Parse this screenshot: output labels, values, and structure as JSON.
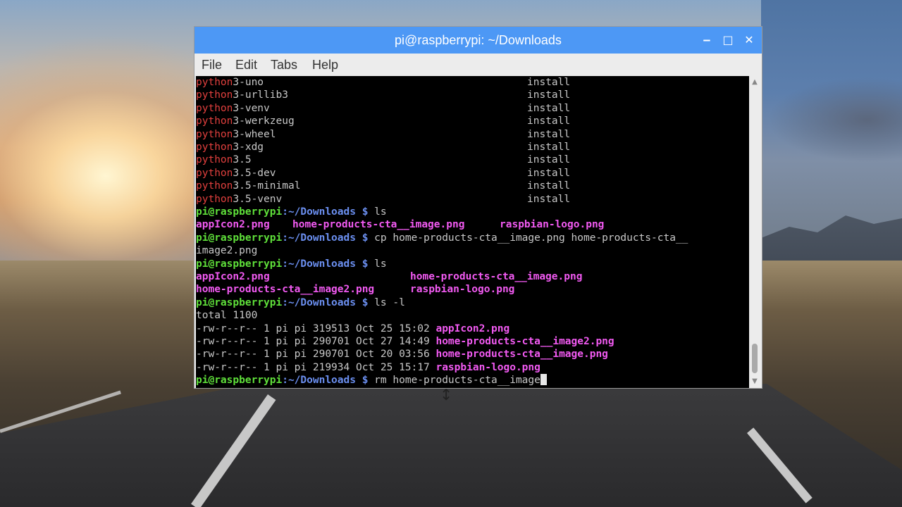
{
  "window": {
    "title": "pi@raspberrypi: ~/Downloads",
    "controls": {
      "minimize": "‒",
      "maximize": "□",
      "close": "✕"
    }
  },
  "menu": [
    "File",
    "Edit",
    "Tabs",
    "Help"
  ],
  "terminal": {
    "packages": [
      {
        "prefix": "python",
        "rest": "3-uno",
        "status": "install"
      },
      {
        "prefix": "python",
        "rest": "3-urllib3",
        "status": "install"
      },
      {
        "prefix": "python",
        "rest": "3-venv",
        "status": "install"
      },
      {
        "prefix": "python",
        "rest": "3-werkzeug",
        "status": "install"
      },
      {
        "prefix": "python",
        "rest": "3-wheel",
        "status": "install"
      },
      {
        "prefix": "python",
        "rest": "3-xdg",
        "status": "install"
      },
      {
        "prefix": "python",
        "rest": "3.5",
        "status": "install"
      },
      {
        "prefix": "python",
        "rest": "3.5-dev",
        "status": "install"
      },
      {
        "prefix": "python",
        "rest": "3.5-minimal",
        "status": "install"
      },
      {
        "prefix": "python",
        "rest": "3.5-venv",
        "status": "install"
      }
    ],
    "prompt_user": "pi@raspberrypi",
    "prompt_path": ":~/Downloads $",
    "cmd1": " ls",
    "ls1": [
      "appIcon2.png",
      "home-products-cta__image.png",
      "raspbian-logo.png"
    ],
    "cmd2": " cp home-products-cta__image.png home-products-cta__",
    "cmd2_wrap": "image2.png",
    "cmd3": " ls",
    "ls2": [
      "appIcon2.png",
      "home-products-cta__image.png",
      "home-products-cta__image2.png",
      "raspbian-logo.png"
    ],
    "cmd4": " ls -l",
    "total": "total 1100",
    "long_list": [
      {
        "meta": "-rw-r--r-- 1 pi pi 319513 Oct 25 15:02 ",
        "name": "appIcon2.png"
      },
      {
        "meta": "-rw-r--r-- 1 pi pi 290701 Oct 27 14:49 ",
        "name": "home-products-cta__image2.png"
      },
      {
        "meta": "-rw-r--r-- 1 pi pi 290701 Oct 20 03:56 ",
        "name": "home-products-cta__image.png"
      },
      {
        "meta": "-rw-r--r-- 1 pi pi 219934 Oct 25 15:17 ",
        "name": "raspbian-logo.png"
      }
    ],
    "cmd5": " rm home-products-cta__image"
  },
  "colors": {
    "titlebar": "#4d98f5",
    "prompt": "#5fe03a",
    "path": "#6b8ff0",
    "file": "#f25af2",
    "package_prefix": "#e2403e"
  }
}
